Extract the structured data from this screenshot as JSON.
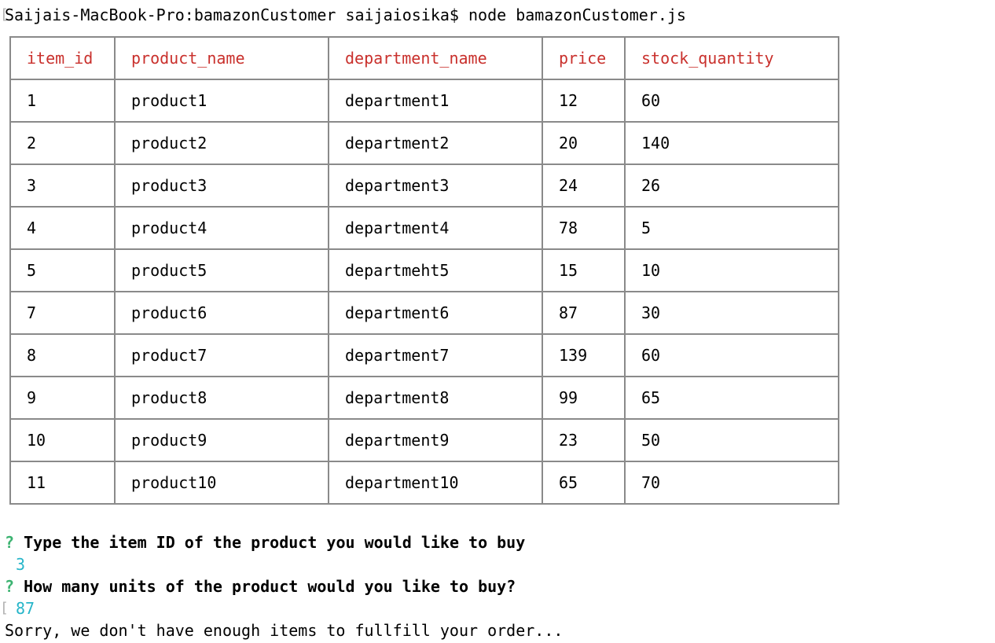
{
  "terminal": {
    "prompt": "Saijais-MacBook-Pro:bamazonCustomer saijaiosika$",
    "command": "node bamazonCustomer.js"
  },
  "table": {
    "headers": [
      "item_id",
      "product_name",
      "department_name",
      "price",
      "stock_quantity"
    ],
    "rows": [
      [
        "1",
        "product1",
        "department1",
        "12",
        "60"
      ],
      [
        "2",
        "product2",
        "department2",
        "20",
        "140"
      ],
      [
        "3",
        "product3",
        "department3",
        "24",
        "26"
      ],
      [
        "4",
        "product4",
        "department4",
        "78",
        "5"
      ],
      [
        "5",
        "product5",
        "departmeht5",
        "15",
        "10"
      ],
      [
        "7",
        "product6",
        "department6",
        "87",
        "30"
      ],
      [
        "8",
        "product7",
        "department7",
        "139",
        "60"
      ],
      [
        "9",
        "product8",
        "department8",
        "99",
        "65"
      ],
      [
        "10",
        "product9",
        "department9",
        "23",
        "50"
      ],
      [
        "11",
        "product10",
        "department10",
        "65",
        "70"
      ]
    ],
    "header_color": "#c9302c"
  },
  "prompts": {
    "q_mark": "?",
    "q1": "Type the item ID of the product you would like to buy",
    "a1": "3",
    "q2": "How many units of the product would you like to buy?",
    "a2": "87",
    "message": "Sorry, we don't have enough items to fullfill your order..."
  },
  "colors": {
    "question_mark": "#3cb371",
    "answer": "#26b5c9"
  }
}
